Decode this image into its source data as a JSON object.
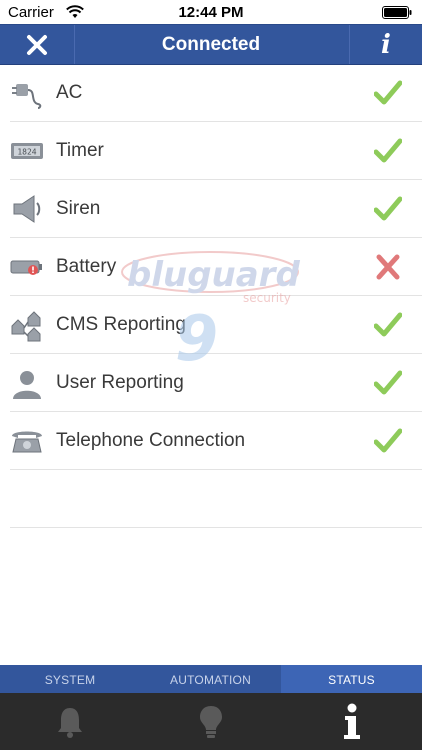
{
  "status_bar": {
    "carrier": "Carrier",
    "time": "12:44 PM"
  },
  "nav": {
    "title": "Connected"
  },
  "items": [
    {
      "label": "AC",
      "icon": "plug-icon",
      "ok": true
    },
    {
      "label": "Timer",
      "icon": "timer-display-icon",
      "ok": true
    },
    {
      "label": "Siren",
      "icon": "speaker-icon",
      "ok": true
    },
    {
      "label": "Battery",
      "icon": "battery-warning-icon",
      "ok": false
    },
    {
      "label": "CMS Reporting",
      "icon": "network-houses-icon",
      "ok": true
    },
    {
      "label": "User Reporting",
      "icon": "user-icon",
      "ok": true
    },
    {
      "label": "Telephone Connection",
      "icon": "telephone-icon",
      "ok": true
    }
  ],
  "timer_display": "1824",
  "watermark": {
    "brand": "bluguard",
    "sub": "security",
    "mark": "9"
  },
  "tabs": [
    {
      "label": "SYSTEM",
      "active": false
    },
    {
      "label": "AUTOMATION",
      "active": false
    },
    {
      "label": "STATUS",
      "active": true
    }
  ],
  "colors": {
    "nav": "#33569c",
    "tab_active": "#3d65b5",
    "ok": "#8ecb5a",
    "error": "#e0797a",
    "bottom_bar": "#2b2b2b"
  }
}
